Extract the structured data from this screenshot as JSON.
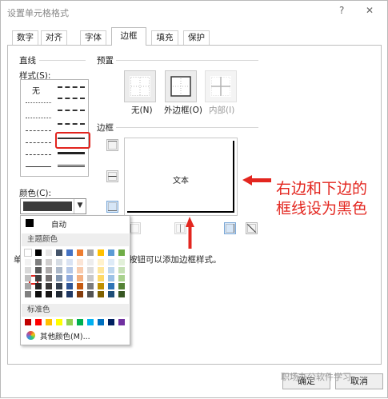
{
  "window": {
    "title": "设置单元格格式",
    "help": "?",
    "close": "✕"
  },
  "tabs": [
    {
      "label": "数字"
    },
    {
      "label": "对齐"
    },
    {
      "label": "字体"
    },
    {
      "label": "边框",
      "active": true
    },
    {
      "label": "填充"
    },
    {
      "label": "保护"
    }
  ],
  "line": {
    "group_label": "直线",
    "style_label": "样式(S):",
    "none_label": "无",
    "color_label": "颜色(C):",
    "selected_color": "#3b3b3b"
  },
  "presets": {
    "group_label": "预置",
    "items": [
      {
        "label": "无(N)"
      },
      {
        "label": "外边框(O)"
      },
      {
        "label": "内部(I)",
        "disabled": true
      }
    ]
  },
  "border": {
    "group_label": "边框",
    "preview_text": "文本"
  },
  "hint": {
    "prefix": "单",
    "text": "按钮可以添加边框样式。"
  },
  "color_popup": {
    "auto_label": "自动",
    "theme_label": "主题颜色",
    "standard_label": "标准色",
    "more_label": "其他颜色(M)...",
    "theme_top": [
      "#ffffff",
      "#000000",
      "#e7e6e6",
      "#44546a",
      "#4472c4",
      "#ed7d31",
      "#a5a5a5",
      "#ffc000",
      "#5b9bd5",
      "#70ad47"
    ],
    "theme_shades": [
      [
        "#f2f2f2",
        "#7f7f7f",
        "#d0cece",
        "#d6dce4",
        "#dae3f3",
        "#fbe5d6",
        "#ededed",
        "#fff2cc",
        "#deebf7",
        "#e2f0d9"
      ],
      [
        "#d9d9d9",
        "#595959",
        "#aeabab",
        "#adb9ca",
        "#b4c7e7",
        "#f8cbad",
        "#dbdbdb",
        "#ffe699",
        "#bdd7ee",
        "#c5e0b4"
      ],
      [
        "#bfbfbf",
        "#404040",
        "#757171",
        "#8497b0",
        "#8faadc",
        "#f4b183",
        "#c9c9c9",
        "#ffd966",
        "#9dc3e6",
        "#a9d18e"
      ],
      [
        "#a6a6a6",
        "#262626",
        "#3a3838",
        "#333f50",
        "#2f5597",
        "#c55a11",
        "#7b7b7b",
        "#bf9000",
        "#2e75b6",
        "#548235"
      ],
      [
        "#7f7f7f",
        "#0d0d0d",
        "#171616",
        "#222a35",
        "#1f3864",
        "#843c0c",
        "#525252",
        "#7f6000",
        "#1f4e79",
        "#385723"
      ]
    ],
    "standard": [
      "#c00000",
      "#ff0000",
      "#ffc000",
      "#ffff00",
      "#92d050",
      "#00b050",
      "#00b0f0",
      "#0070c0",
      "#002060",
      "#7030a0"
    ]
  },
  "buttons": {
    "ok": "确定",
    "cancel": "取消"
  },
  "annotation": {
    "line1": "右边和下边的",
    "line2": "框线设为黑色"
  },
  "watermark": "职场办公软件学习",
  "accent_color": "#e2241e"
}
